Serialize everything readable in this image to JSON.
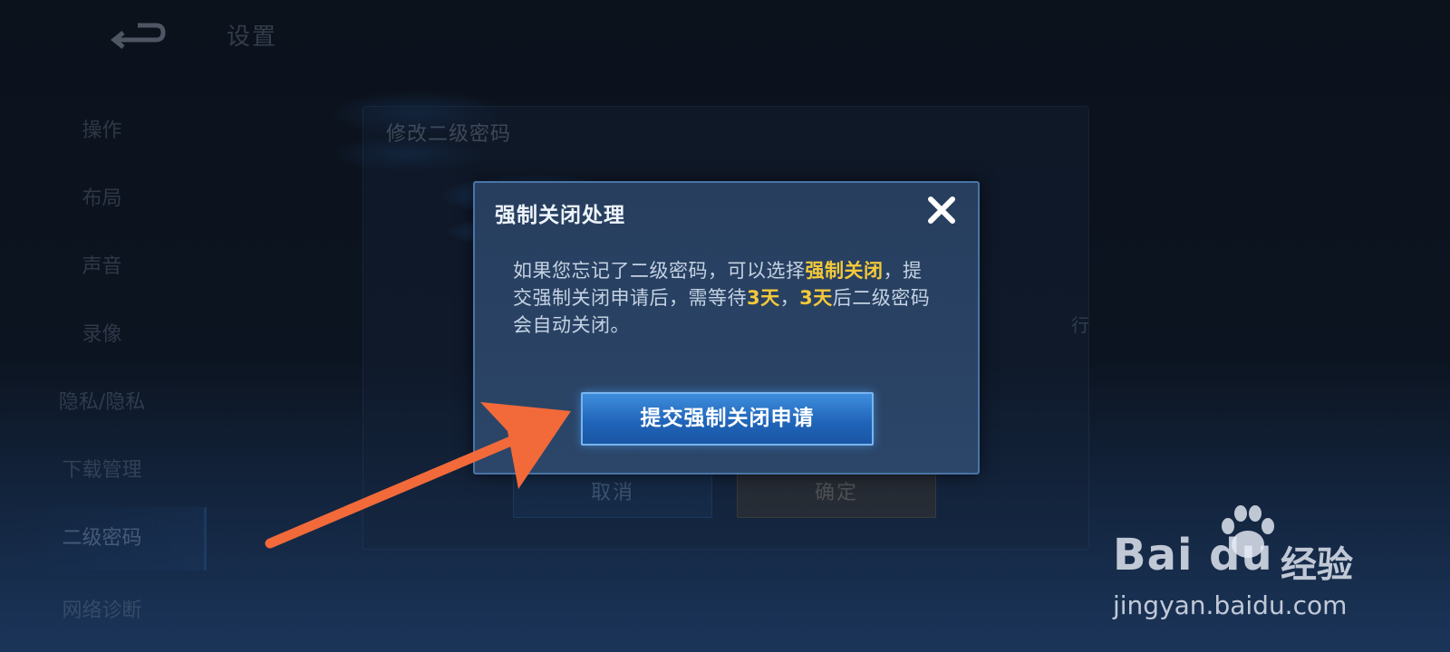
{
  "header": {
    "title": "设置"
  },
  "sidebar": {
    "items": [
      {
        "label": "操作"
      },
      {
        "label": "布局"
      },
      {
        "label": "声音"
      },
      {
        "label": "录像"
      },
      {
        "label": "隐私/隐私"
      },
      {
        "label": "下载管理"
      },
      {
        "label": "二级密码"
      },
      {
        "label": "网络诊断"
      }
    ]
  },
  "background_panel": {
    "title": "修改二级密码",
    "cancel_label": "取消",
    "confirm_label": "确定",
    "side_hint": "行"
  },
  "dialog": {
    "title": "强制关闭处理",
    "body": {
      "p1": "如果您忘记了二级密码，可以选择",
      "h1": "强制关闭",
      "p2": "，提交强制关闭申请后，需等待",
      "h2": "3天",
      "p3": "，",
      "h3": "3天",
      "p4": "后二级密码会自动关闭。"
    },
    "submit_label": "提交强制关闭申请"
  },
  "watermark": {
    "logo": "Bai du",
    "brand_cn": "经验",
    "url": "jingyan.baidu.com"
  },
  "colors": {
    "highlight": "#f4c93a",
    "arrow": "#f26a3a",
    "button_blue": "#2a74c8"
  }
}
